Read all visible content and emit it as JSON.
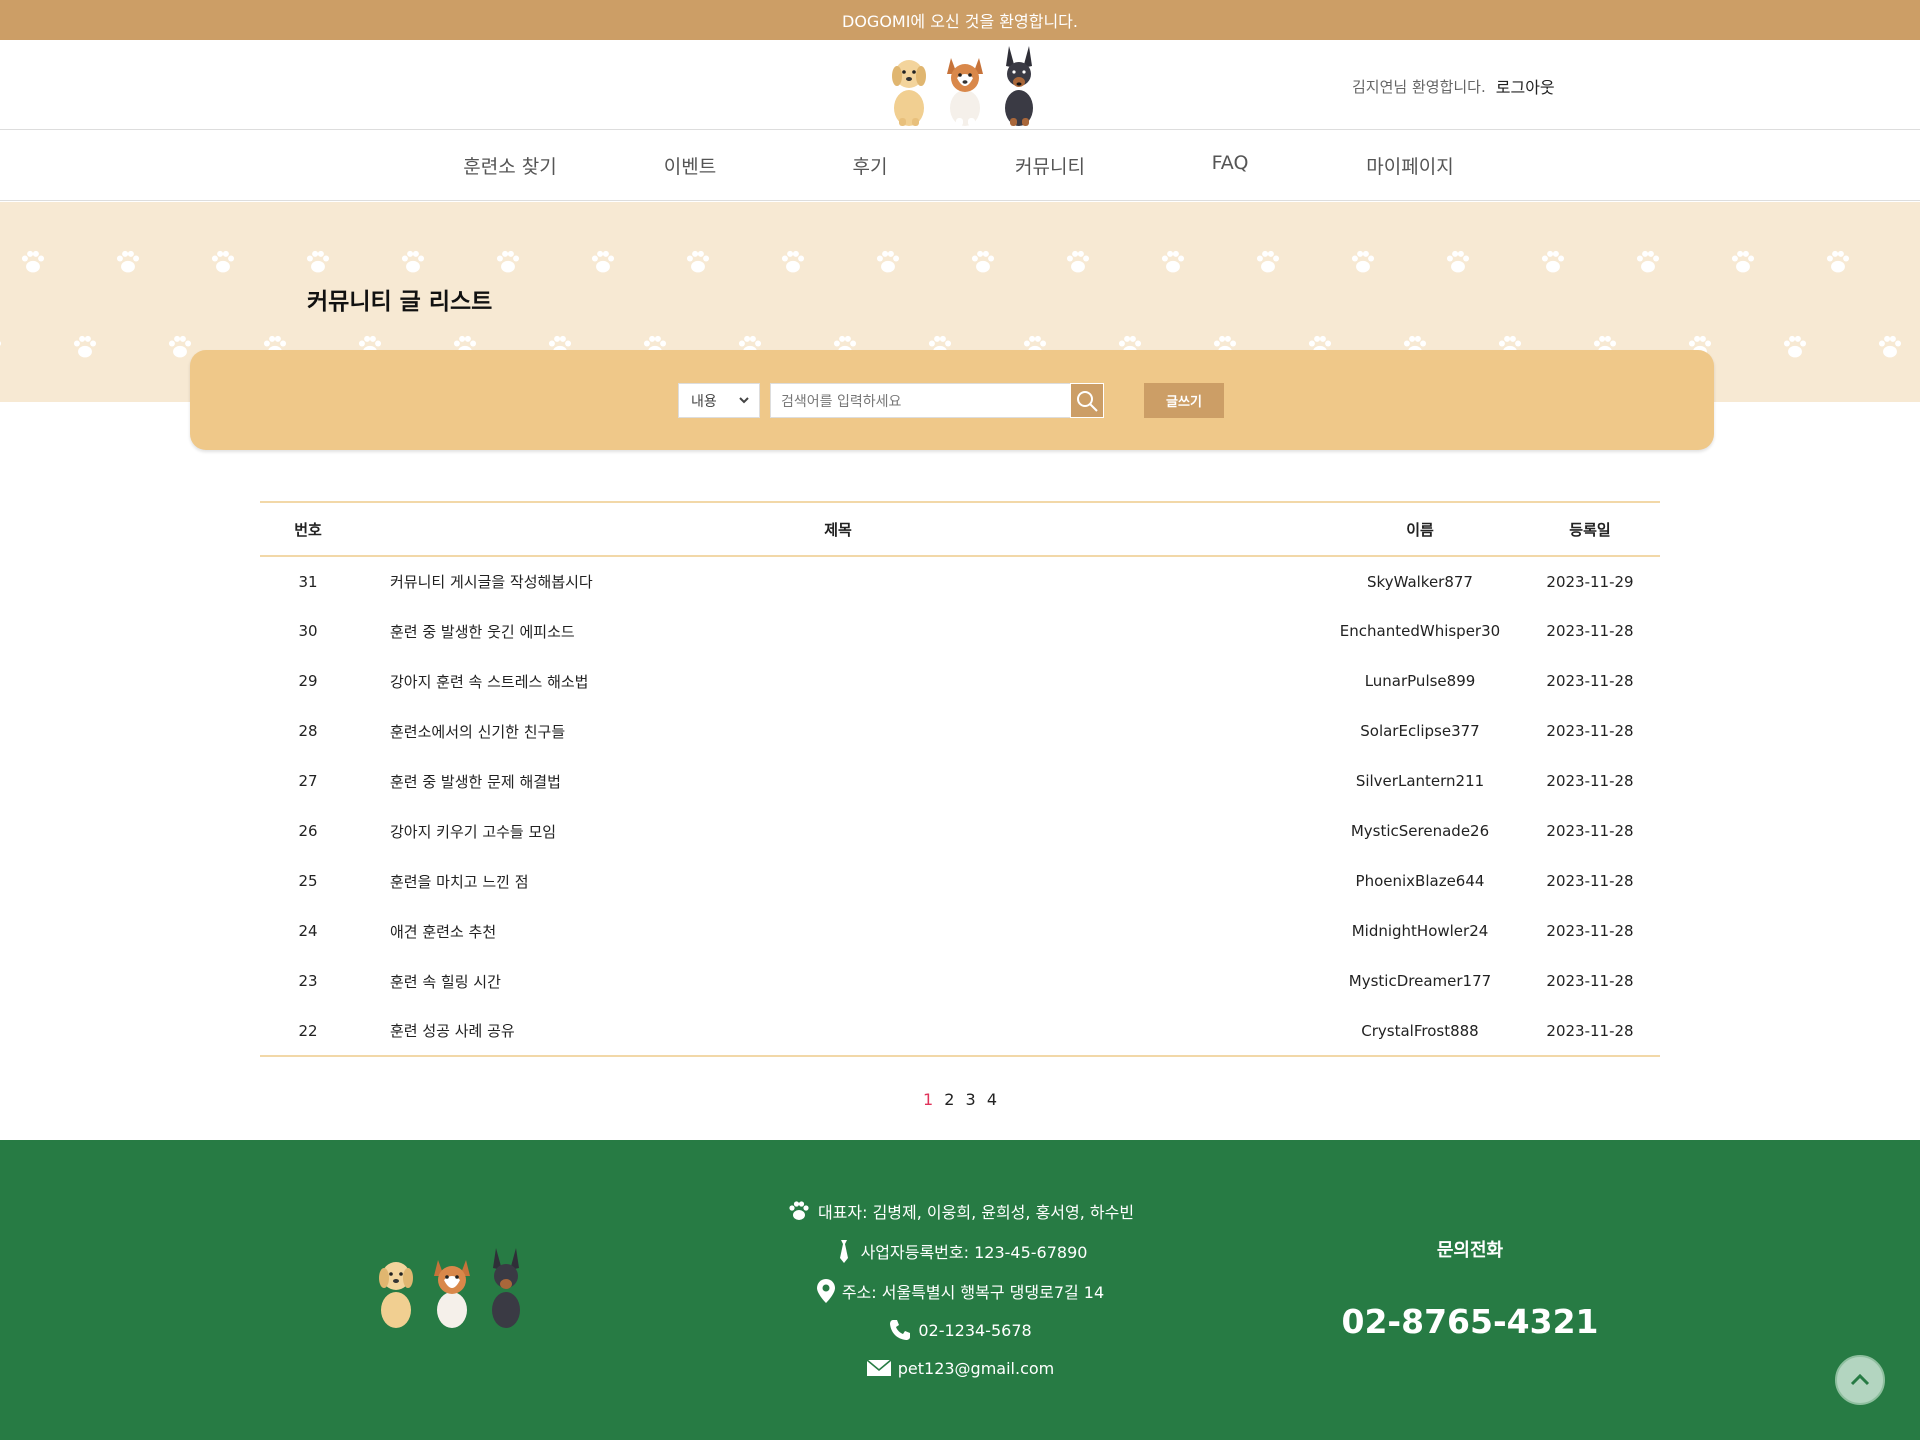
{
  "topbar": {
    "text": "DOGOMI에 오신 것을 환영합니다."
  },
  "header": {
    "greeting": "김지연님 환영합니다.",
    "logout": "로그아웃"
  },
  "nav": {
    "items": [
      "훈련소 찾기",
      "이벤트",
      "후기",
      "커뮤니티",
      "FAQ",
      "마이페이지"
    ]
  },
  "page": {
    "title": "커뮤니티 글 리스트"
  },
  "search": {
    "select_value": "내용",
    "placeholder": "검색어를 입력하세요",
    "write_label": "글쓰기"
  },
  "table": {
    "headers": {
      "no": "번호",
      "title": "제목",
      "name": "이름",
      "date": "등록일"
    },
    "rows": [
      {
        "no": "31",
        "title": "커뮤니티 게시글을 작성해봅시다",
        "name": "SkyWalker877",
        "date": "2023-11-29"
      },
      {
        "no": "30",
        "title": "훈련 중 발생한 웃긴 에피소드",
        "name": "EnchantedWhisper30",
        "date": "2023-11-28"
      },
      {
        "no": "29",
        "title": "강아지 훈련 속 스트레스 해소법",
        "name": "LunarPulse899",
        "date": "2023-11-28"
      },
      {
        "no": "28",
        "title": "훈련소에서의 신기한 친구들",
        "name": "SolarEclipse377",
        "date": "2023-11-28"
      },
      {
        "no": "27",
        "title": "훈련 중 발생한 문제 해결법",
        "name": "SilverLantern211",
        "date": "2023-11-28"
      },
      {
        "no": "26",
        "title": "강아지 키우기 고수들 모임",
        "name": "MysticSerenade26",
        "date": "2023-11-28"
      },
      {
        "no": "25",
        "title": "훈련을 마치고 느낀 점",
        "name": "PhoenixBlaze644",
        "date": "2023-11-28"
      },
      {
        "no": "24",
        "title": "애견 훈련소 추천",
        "name": "MidnightHowler24",
        "date": "2023-11-28"
      },
      {
        "no": "23",
        "title": "훈련 속 힐링 시간",
        "name": "MysticDreamer177",
        "date": "2023-11-28"
      },
      {
        "no": "22",
        "title": "훈련 성공 사례 공유",
        "name": "CrystalFrost888",
        "date": "2023-11-28"
      }
    ]
  },
  "pagination": {
    "pages": [
      "1",
      "2",
      "3",
      "4"
    ],
    "current": "1"
  },
  "footer": {
    "ceo": "대표자: 김병제, 이웅희, 윤희성, 홍서영, 하수빈",
    "business_no": "사업자등록번호: 123-45-67890",
    "address": "주소: 서울특별시 행복구 댕댕로7길 14",
    "phone": "02-1234-5678",
    "email": "pet123@gmail.com",
    "contact_title": "문의전화",
    "contact_phone": "02-8765-4321"
  },
  "colors": {
    "topbar": "#cc9e66",
    "banner": "#f7e9d3",
    "search_panel": "#efc889",
    "footer": "#277b44",
    "active_page": "#e0335a"
  },
  "icons": {
    "logo": "three-dogs-logo",
    "search": "search-icon",
    "select": "chevron-down-icon",
    "footer_ceo": "paw-icon",
    "footer_business": "tie-icon",
    "footer_address": "location-pin-icon",
    "footer_phone": "phone-icon",
    "footer_email": "mail-icon",
    "scroll_top": "chevron-up-icon"
  }
}
